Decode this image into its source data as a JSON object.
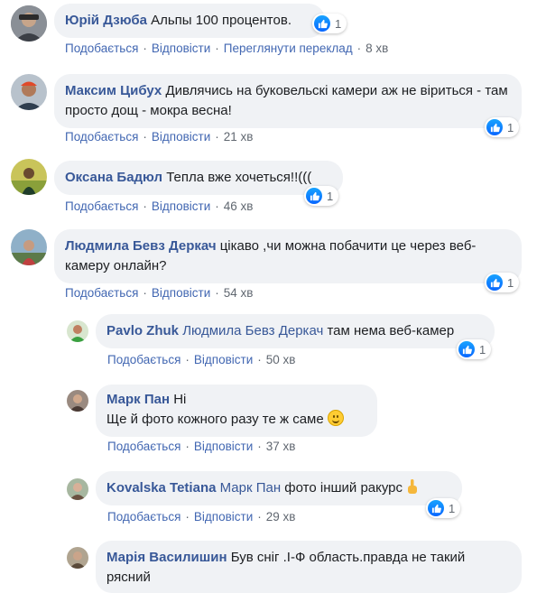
{
  "actions": {
    "like": "Подобається",
    "reply": "Відповісти",
    "see_translation": "Переглянути переклад",
    "separator": "·"
  },
  "comments": [
    {
      "author": "Юрій Дзюба",
      "text": "Альпы 100 процентов.",
      "reactions": "1",
      "time": "8 хв"
    },
    {
      "author": "Максим Цибух",
      "text": "Дивлячись на буковельскі камери аж не віриться - там просто дощ - мокра весна!",
      "reactions": "1",
      "time": "21 хв"
    },
    {
      "author": "Оксана Бадюл",
      "text": "Тепла вже хочеться!!(((",
      "reactions": "1",
      "time": "46 хв"
    },
    {
      "author": "Людмила Бевз Деркач",
      "text": "цікаво ,чи можна побачити це через веб-камеру онлайн?",
      "reactions": "1",
      "time": "54 хв"
    }
  ],
  "replies": [
    {
      "author": "Pavlo Zhuk",
      "mention": "Людмила Бевз Деркач",
      "text": "там нема веб-камер",
      "reactions": "1",
      "time": "50 хв"
    },
    {
      "author": "Марк Пан",
      "text_line1": "Ні",
      "text_line2": "Ще й фото кожного разу те ж саме",
      "emoji": "slightly-smiling-face",
      "time": "37 хв"
    },
    {
      "author": "Kovalska Tetiana",
      "mention": "Марк Пан",
      "text": "фото інший ракурс",
      "emoji": "pointing-up-hand",
      "reactions": "1",
      "time": "29 хв"
    },
    {
      "author": "Марія Василишин",
      "text": "Був сніг .І-Ф область.правда не такий рясний"
    }
  ]
}
